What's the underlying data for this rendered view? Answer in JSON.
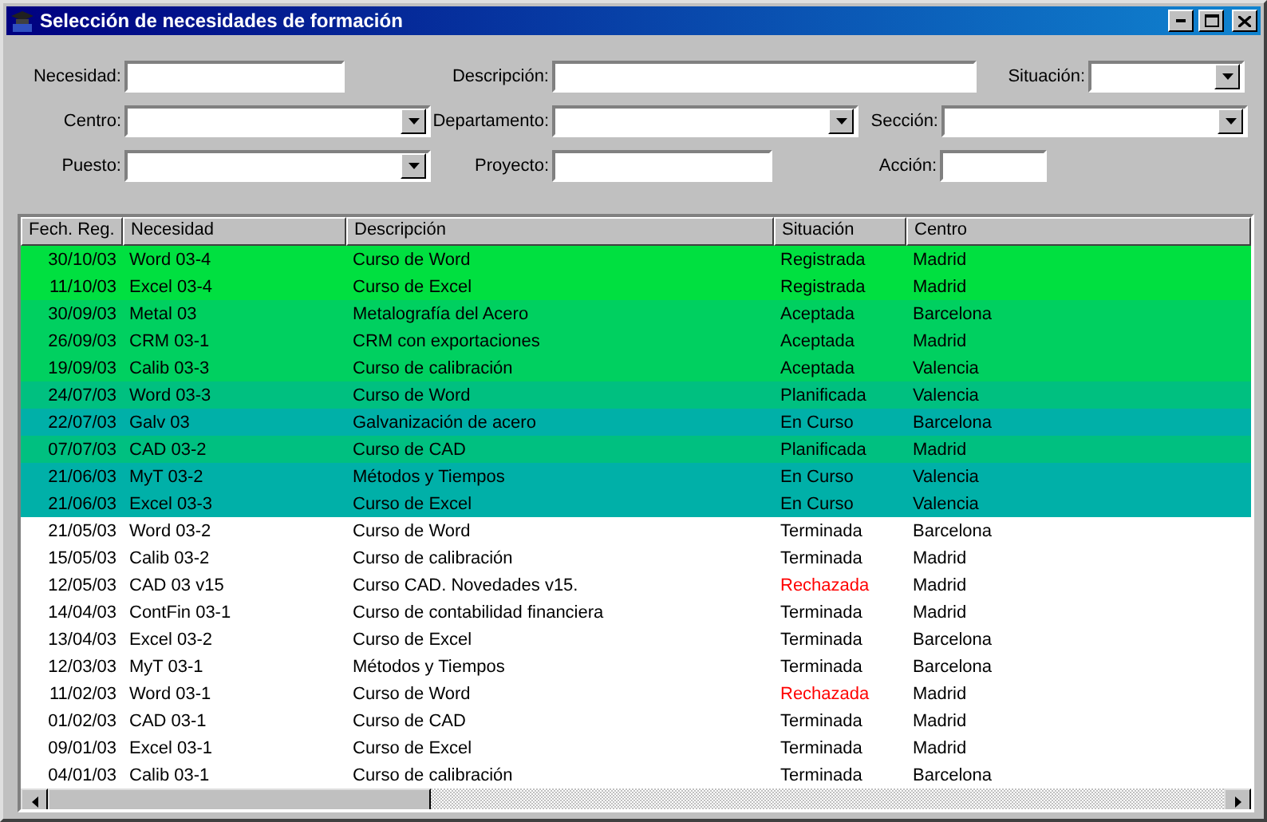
{
  "window": {
    "title": "Selección de necesidades de formación"
  },
  "filters": [
    [
      {
        "label": "Necesidad:",
        "kind": "text"
      },
      {
        "label": "Descripción:",
        "kind": "text"
      },
      {
        "label": "Situación:",
        "kind": "combo"
      }
    ],
    [
      {
        "label": "Centro:",
        "kind": "combo"
      },
      {
        "label": "Departamento:",
        "kind": "combo"
      },
      {
        "label": "Sección:",
        "kind": "combo"
      }
    ],
    [
      {
        "label": "Puesto:",
        "kind": "combo"
      },
      {
        "label": "Proyecto:",
        "kind": "text"
      },
      {
        "label": "Acción:",
        "kind": "text"
      }
    ]
  ],
  "table": {
    "columns": [
      "Fech. Reg.",
      "Necesidad",
      "Descripción",
      "Situación",
      "Centro"
    ],
    "rows": [
      {
        "cells": [
          "30/10/03",
          "Word 03-4",
          "Curso de Word",
          "Registrada",
          "Madrid"
        ],
        "color": "#00e040",
        "rejected": false
      },
      {
        "cells": [
          "11/10/03",
          "Excel 03-4",
          "Curso de Excel",
          "Registrada",
          "Madrid"
        ],
        "color": "#00e040",
        "rejected": false
      },
      {
        "cells": [
          "30/09/03",
          "Metal 03",
          "Metalografía del Acero",
          "Aceptada",
          "Barcelona"
        ],
        "color": "#00d060",
        "rejected": false
      },
      {
        "cells": [
          "26/09/03",
          "CRM 03-1",
          "CRM con exportaciones",
          "Aceptada",
          "Madrid"
        ],
        "color": "#00d060",
        "rejected": false
      },
      {
        "cells": [
          "19/09/03",
          "Calib 03-3",
          "Curso de calibración",
          "Aceptada",
          "Valencia"
        ],
        "color": "#00d060",
        "rejected": false
      },
      {
        "cells": [
          "24/07/03",
          "Word 03-3",
          "Curso de Word",
          "Planificada",
          "Valencia"
        ],
        "color": "#00c080",
        "rejected": false
      },
      {
        "cells": [
          "22/07/03",
          "Galv 03",
          "Galvanización de acero",
          "En Curso",
          "Barcelona"
        ],
        "color": "#00b0a8",
        "rejected": false
      },
      {
        "cells": [
          "07/07/03",
          "CAD 03-2",
          "Curso de CAD",
          "Planificada",
          "Madrid"
        ],
        "color": "#00c080",
        "rejected": false
      },
      {
        "cells": [
          "21/06/03",
          "MyT 03-2",
          "Métodos y Tiempos",
          "En Curso",
          "Valencia"
        ],
        "color": "#00b0a8",
        "rejected": false
      },
      {
        "cells": [
          "21/06/03",
          "Excel 03-3",
          "Curso de Excel",
          "En Curso",
          "Valencia"
        ],
        "color": "#00b0a8",
        "rejected": false
      },
      {
        "cells": [
          "21/05/03",
          "Word 03-2",
          "Curso de Word",
          "Terminada",
          "Barcelona"
        ],
        "color": "#ffffff",
        "rejected": false
      },
      {
        "cells": [
          "15/05/03",
          "Calib 03-2",
          "Curso de calibración",
          "Terminada",
          "Madrid"
        ],
        "color": "#ffffff",
        "rejected": false
      },
      {
        "cells": [
          "12/05/03",
          "CAD 03 v15",
          "Curso CAD. Novedades v15.",
          "Rechazada",
          "Madrid"
        ],
        "color": "#ffffff",
        "rejected": true
      },
      {
        "cells": [
          "14/04/03",
          "ContFin 03-1",
          "Curso de contabilidad financiera",
          "Terminada",
          "Madrid"
        ],
        "color": "#ffffff",
        "rejected": false
      },
      {
        "cells": [
          "13/04/03",
          "Excel 03-2",
          "Curso de Excel",
          "Terminada",
          "Barcelona"
        ],
        "color": "#ffffff",
        "rejected": false
      },
      {
        "cells": [
          "12/03/03",
          "MyT 03-1",
          "Métodos y Tiempos",
          "Terminada",
          "Barcelona"
        ],
        "color": "#ffffff",
        "rejected": false
      },
      {
        "cells": [
          "11/02/03",
          "Word 03-1",
          "Curso de Word",
          "Rechazada",
          "Madrid"
        ],
        "color": "#ffffff",
        "rejected": true
      },
      {
        "cells": [
          "01/02/03",
          "CAD 03-1",
          "Curso de CAD",
          "Terminada",
          "Madrid"
        ],
        "color": "#ffffff",
        "rejected": false
      },
      {
        "cells": [
          "09/01/03",
          "Excel 03-1",
          "Curso de Excel",
          "Terminada",
          "Madrid"
        ],
        "color": "#ffffff",
        "rejected": false
      },
      {
        "cells": [
          "04/01/03",
          "Calib 03-1",
          "Curso de calibración",
          "Terminada",
          "Barcelona"
        ],
        "color": "#ffffff",
        "rejected": false
      }
    ]
  }
}
